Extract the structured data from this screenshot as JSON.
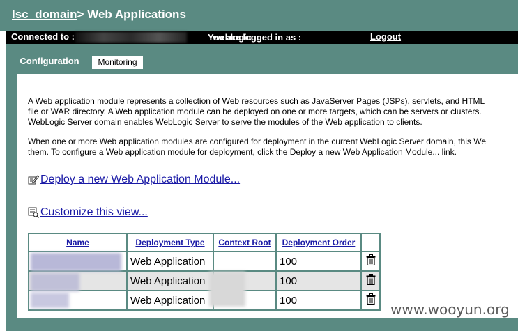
{
  "header": {
    "domain": "lsc_domain",
    "separator": ">",
    "title": "Web Applications"
  },
  "status_bar": {
    "connected_label": "Connected to :",
    "logged_in_label": "You are logged in as :",
    "user": "weblogic",
    "logout": "Logout"
  },
  "tabs": [
    {
      "label": "Configuration"
    },
    {
      "label": "Monitoring"
    }
  ],
  "description": {
    "p1": [
      "A Web application module represents a collection of Web resources such as JavaServer Pages (JSPs), servlets, and HTML",
      "file or WAR directory. A Web application module can be deployed on one or more targets, which can be servers or clusters.",
      "WebLogic Server domain enables WebLogic Server to serve the modules of the Web application to clients."
    ],
    "p2": [
      "When one or more Web application modules are configured for deployment in the current WebLogic Server domain, this We",
      "them. To configure a Web application module for deployment, click the Deploy a new Web Application Module... link."
    ]
  },
  "actions": {
    "deploy": "Deploy a new Web Application Module...",
    "customize": "Customize this view..."
  },
  "table": {
    "headers": [
      "Name",
      "Deployment Type",
      "Context Root",
      "Deployment Order"
    ],
    "rows": [
      {
        "type": "Web Application",
        "context_root": "",
        "order": "100"
      },
      {
        "type": "Web Application",
        "context_root": "",
        "order": "100"
      },
      {
        "type": "Web Application",
        "context_root": "",
        "order": "100"
      }
    ]
  },
  "watermark": "www.wooyun.org",
  "icons": {
    "deploy": "edit-icon",
    "customize": "customize-view-icon",
    "delete": "trash-icon"
  },
  "colors": {
    "header_bg": "#5a8a82",
    "link": "#1a1aa6",
    "status_bg": "#000000",
    "alt_row": "#e5e5e5"
  }
}
